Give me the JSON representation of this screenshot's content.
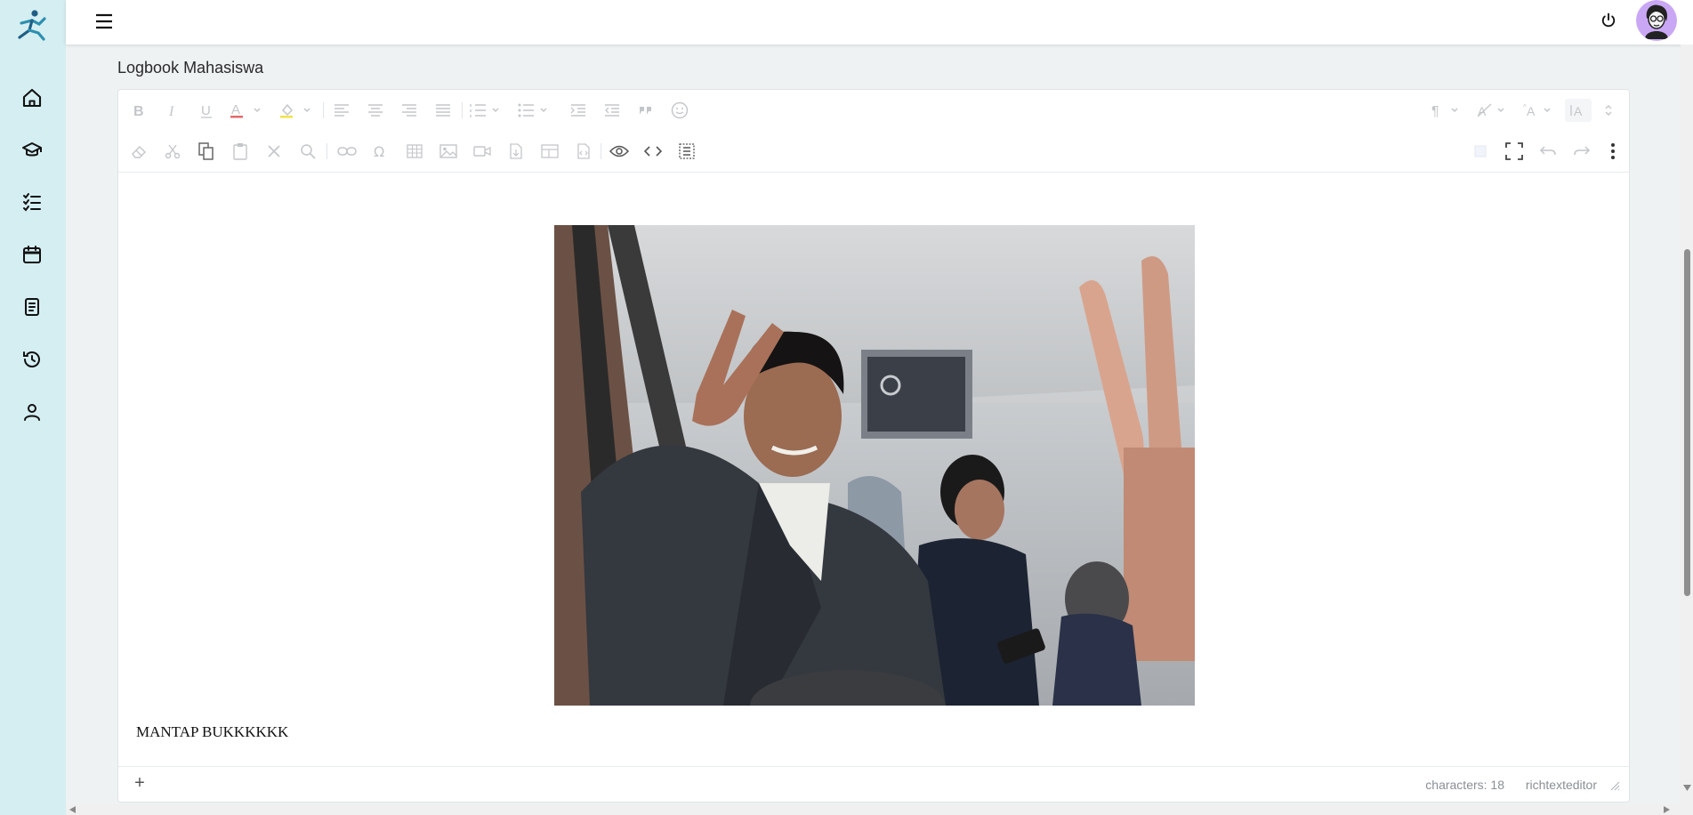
{
  "app": {
    "logo_icon": "runner-logo-icon"
  },
  "sidebar": {
    "items": [
      {
        "name": "home",
        "icon": "home-icon"
      },
      {
        "name": "courses",
        "icon": "graduation-cap-icon"
      },
      {
        "name": "tasks",
        "icon": "checklist-icon"
      },
      {
        "name": "calendar",
        "icon": "calendar-icon"
      },
      {
        "name": "reports",
        "icon": "document-icon"
      },
      {
        "name": "history",
        "icon": "history-icon"
      },
      {
        "name": "profile",
        "icon": "user-icon"
      }
    ]
  },
  "header": {
    "menu_icon": "hamburger-icon",
    "power_icon": "power-icon",
    "avatar_icon": "avatar"
  },
  "page": {
    "title": "Logbook Mahasiswa"
  },
  "editor": {
    "content_text": "MANTAP BUKKKKKK",
    "status": {
      "characters": "characters: 18",
      "brand": "richtexteditor"
    },
    "add_label": "+"
  },
  "colors": {
    "sidebar_bg": "#d5eef2",
    "accent": "#1a7fa0"
  }
}
